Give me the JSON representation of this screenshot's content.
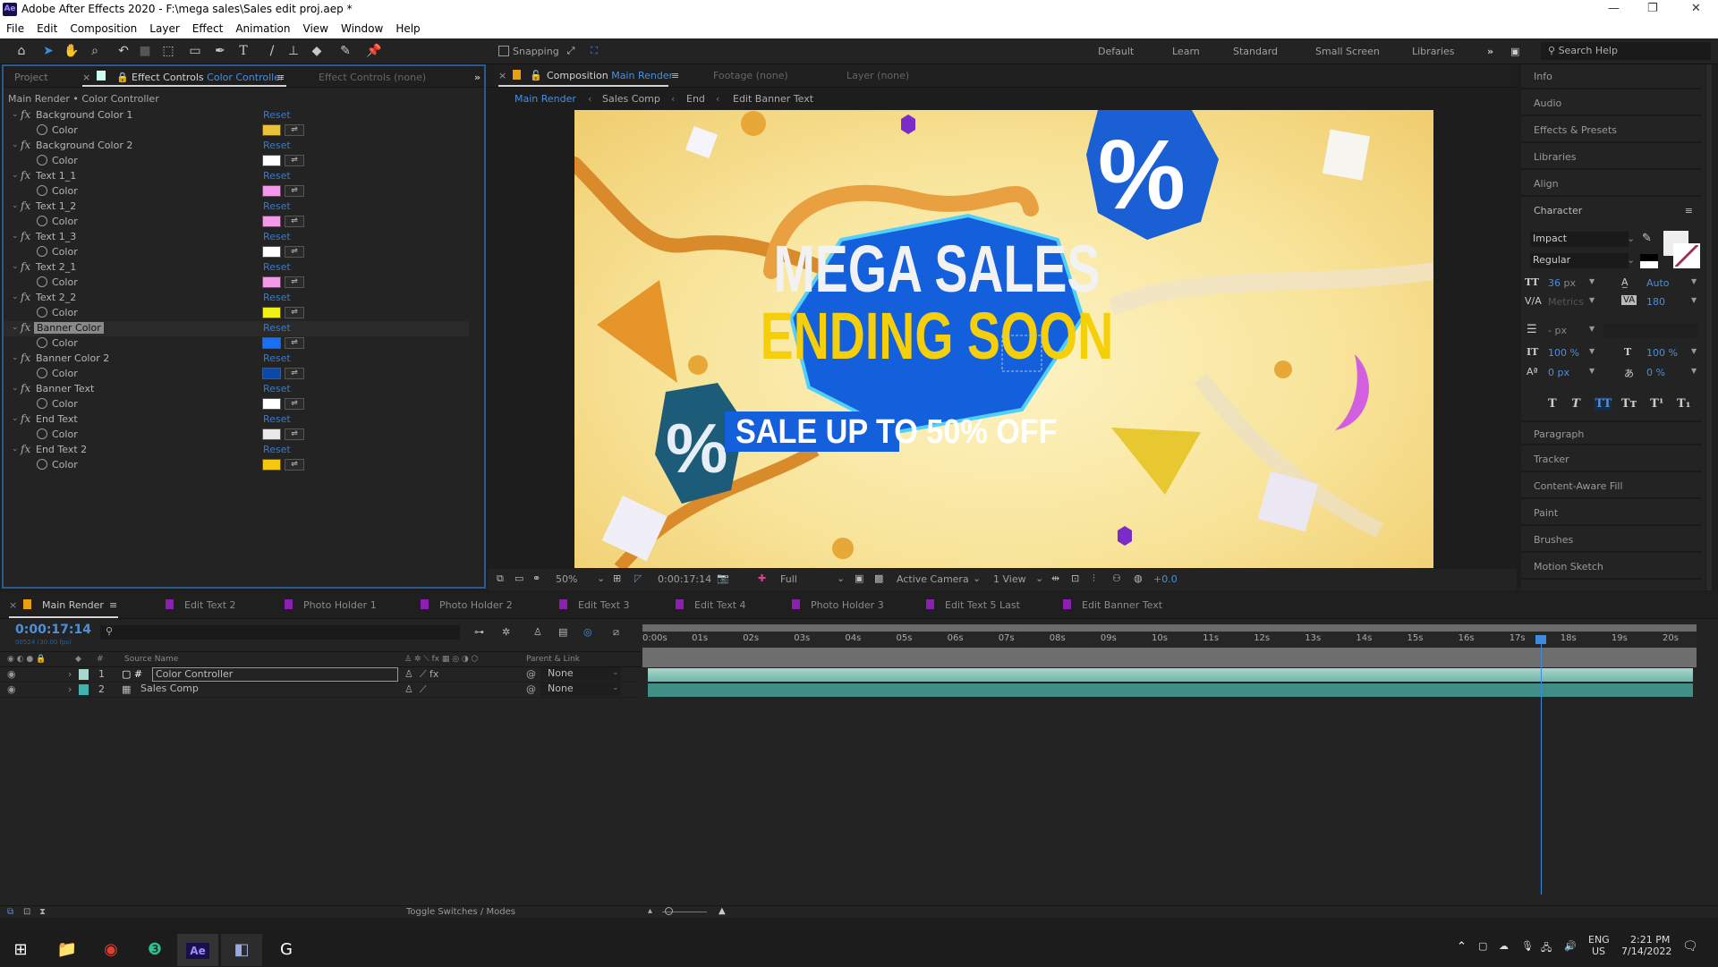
{
  "window": {
    "title": "Adobe After Effects 2020 - F:\\mega sales\\Sales edit proj.aep *",
    "logo": "Ae"
  },
  "menu": [
    "File",
    "Edit",
    "Composition",
    "Layer",
    "Effect",
    "Animation",
    "View",
    "Window",
    "Help"
  ],
  "toolbar": {
    "snapping_label": "Snapping",
    "workspaces": [
      "Default",
      "Learn",
      "Standard",
      "Small Screen",
      "Libraries"
    ],
    "search_help": "Search Help"
  },
  "effect_controls": {
    "tabs": {
      "project": "Project",
      "ec_prefix": "Effect Controls",
      "ec_layer": "Color Controller",
      "ec_none": "Effect Controls (none)"
    },
    "breadcrumb": "Main Render • Color Controller",
    "effects": [
      {
        "name": "Background Color 1",
        "param": "Color",
        "reset": "Reset",
        "color": "#e8c23a"
      },
      {
        "name": "Background Color 2",
        "param": "Color",
        "reset": "Reset",
        "color": "#ffffff"
      },
      {
        "name": "Text 1_1",
        "param": "Color",
        "reset": "Reset",
        "color": "#f29ae8"
      },
      {
        "name": "Text 1_2",
        "param": "Color",
        "reset": "Reset",
        "color": "#f29ae8"
      },
      {
        "name": "Text 1_3",
        "param": "Color",
        "reset": "Reset",
        "color": "#ffffff"
      },
      {
        "name": "Text 2_1",
        "param": "Color",
        "reset": "Reset",
        "color": "#f29ae8"
      },
      {
        "name": "Text 2_2",
        "param": "Color",
        "reset": "Reset",
        "color": "#f0f018"
      },
      {
        "name": "Banner Color",
        "param": "Color",
        "reset": "Reset",
        "color": "#1a6ff2",
        "selected": true
      },
      {
        "name": "Banner Color 2",
        "param": "Color",
        "reset": "Reset",
        "color": "#0b48a8"
      },
      {
        "name": "Banner Text",
        "param": "Color",
        "reset": "Reset",
        "color": "#ffffff"
      },
      {
        "name": "End Text",
        "param": "Color",
        "reset": "Reset",
        "color": "#e8e8e8"
      },
      {
        "name": "End Text 2",
        "param": "Color",
        "reset": "Reset",
        "color": "#f5c80f"
      }
    ]
  },
  "composition": {
    "tab_prefix": "Composition",
    "tab_name": "Main Render",
    "footage": "Footage (none)",
    "layer": "Layer (none)",
    "breadcrumbs": [
      "Main Render",
      "Sales Comp",
      "End",
      "Edit Banner Text"
    ],
    "preview": {
      "line1": "MEGA SALES",
      "line2": "ENDING SOON",
      "banner": "SALE UP TO 50% OFF",
      "percent": "%"
    },
    "viewer_bar": {
      "zoom": "50%",
      "timecode": "0:00:17:14",
      "resolution": "Full",
      "camera": "Active Camera",
      "views": "1 View",
      "exposure": "+0.0"
    }
  },
  "right_panel": {
    "top_items": [
      "Info",
      "Audio",
      "Effects & Presets",
      "Libraries",
      "Align"
    ],
    "character": {
      "title": "Character",
      "font": "Impact",
      "style": "Regular",
      "size": "36",
      "size_unit": "px",
      "leading": "Auto",
      "kerning": "Metrics",
      "tracking": "180",
      "stroke_unit": "- px",
      "vscale": "100 %",
      "hscale": "100 %",
      "baseline": "0 px",
      "tsume": "0 %",
      "styles": [
        "T",
        "T",
        "TT",
        "Tт",
        "T¹",
        "T₁"
      ]
    },
    "bottom_items": [
      "Paragraph",
      "Tracker",
      "Content-Aware Fill",
      "Paint",
      "Brushes",
      "Motion Sketch"
    ]
  },
  "timeline": {
    "tabs": [
      "Main Render",
      "Edit Text 2",
      "Photo Holder 1",
      "Photo Holder 2",
      "Edit Text 3",
      "Edit Text 4",
      "Photo Holder 3",
      "Edit Text 5 Last",
      "Edit Banner Text"
    ],
    "timecode": "0:00:17:14",
    "frames": "00524 (30.00 fps)",
    "columns": {
      "source_name": "Source Name",
      "parent": "Parent & Link",
      "num": "#"
    },
    "layers": [
      {
        "num": "1",
        "name": "Color Controller",
        "parent": "None",
        "label_color": "#a6d8d0"
      },
      {
        "num": "2",
        "name": "Sales Comp",
        "parent": "None",
        "label_color": "#3fb3ad"
      }
    ],
    "ruler": [
      "0:00s",
      "01s",
      "02s",
      "03s",
      "04s",
      "05s",
      "06s",
      "07s",
      "08s",
      "09s",
      "10s",
      "11s",
      "12s",
      "13s",
      "14s",
      "15s",
      "16s",
      "17s",
      "18s",
      "19s",
      "20s"
    ],
    "playhead_seconds": 17.47,
    "duration_seconds": 20.5,
    "footer": "Toggle Switches / Modes"
  },
  "taskbar": {
    "lang1": "ENG",
    "lang2": "US",
    "time": "2:21 PM",
    "date": "7/14/2022"
  }
}
